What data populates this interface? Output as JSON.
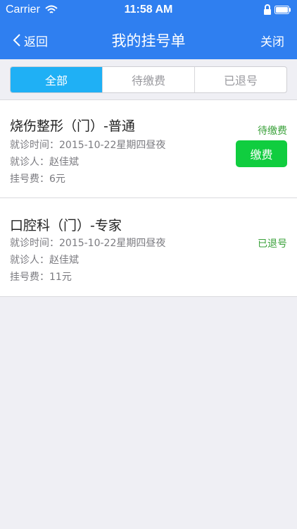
{
  "status_bar": {
    "carrier": "Carrier",
    "time": "11:58 AM",
    "icons": [
      "wifi-icon",
      "lock-icon",
      "battery-icon"
    ]
  },
  "nav": {
    "back_label": "返回",
    "title": "我的挂号单",
    "close_label": "关闭"
  },
  "tabs": [
    {
      "label": "全部",
      "active": true
    },
    {
      "label": "待缴费",
      "active": false
    },
    {
      "label": "已退号",
      "active": false
    }
  ],
  "records": [
    {
      "title": "烧伤整形（门）-普通",
      "visit_time": "就诊时间：2015-10-22星期四昼夜",
      "patient": "就诊人：赵佳斌",
      "fee": "挂号费：6元",
      "status": "待缴费",
      "action_label": "缴费"
    },
    {
      "title": "口腔科（门）-专家",
      "visit_time": "就诊时间：2015-10-22星期四昼夜",
      "patient": "就诊人：赵佳斌",
      "fee": "挂号费：11元",
      "status": "已退号"
    }
  ],
  "colors": {
    "nav_bg": "#2f7ff0",
    "tab_active": "#1fb0f5",
    "status_text": "#3aa13a",
    "pay_button": "#10cd3f",
    "background": "#efeff4"
  }
}
